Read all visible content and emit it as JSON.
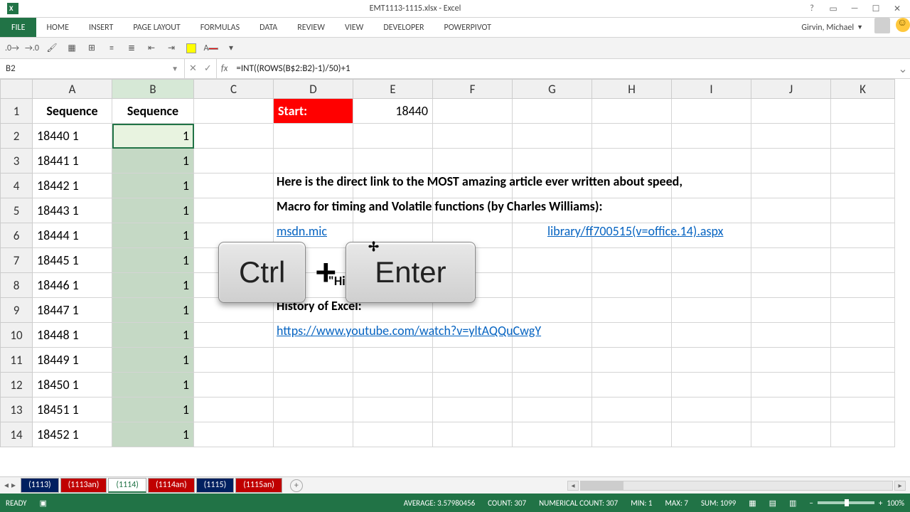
{
  "title": "EMT1113-1115.xlsx - Excel",
  "ribbon": {
    "file": "FILE",
    "tabs": [
      "HOME",
      "INSERT",
      "PAGE LAYOUT",
      "FORMULAS",
      "DATA",
      "REVIEW",
      "VIEW",
      "DEVELOPER",
      "POWERPIVOT"
    ],
    "user": "Girvin, Michael"
  },
  "help_icon": "?",
  "namebox": "B2",
  "formula": "=INT((ROWS(B$2:B2)-1)/50)+1",
  "columns": [
    "A",
    "B",
    "C",
    "D",
    "E",
    "F",
    "G",
    "H",
    "I",
    "J",
    "K"
  ],
  "row_numbers": [
    1,
    2,
    3,
    4,
    5,
    6,
    7,
    8,
    9,
    10,
    11,
    12,
    13,
    14
  ],
  "headers": {
    "A": "Sequence",
    "B": "Sequence"
  },
  "start_label": "Start:",
  "start_value": "18440",
  "colA": [
    "18440 1",
    "18441 1",
    "18442 1",
    "18443 1",
    "18444 1",
    "18445 1",
    "18446 1",
    "18447 1",
    "18448 1",
    "18449 1",
    "18450 1",
    "18451 1",
    "18452 1"
  ],
  "colB": [
    "1",
    "1",
    "1",
    "1",
    "1",
    "1",
    "1",
    "1",
    "1",
    "1",
    "1",
    "1",
    "1"
  ],
  "body_text": {
    "line1": "Here is the direct link to the MOST amazing article ever written about speed,",
    "line2": "Macro for timing and Volatile functions (by Charles Williams):",
    "link1_left": "msdn.mic",
    "link1_right": "library/ff700515(v=office.14).aspx",
    "high_prie": "\"High Prie",
    "history": "History of Excel:",
    "link2": "https://www.youtube.com/watch?v=yltAQQuCwgY"
  },
  "sheet_tabs": [
    {
      "label": "(1113)",
      "cls": "blue"
    },
    {
      "label": "(1113an)",
      "cls": "red"
    },
    {
      "label": "(1114)",
      "cls": "active"
    },
    {
      "label": "(1114an)",
      "cls": "red"
    },
    {
      "label": "(1115)",
      "cls": "blue"
    },
    {
      "label": "(1115an)",
      "cls": "red"
    }
  ],
  "status": {
    "ready": "READY",
    "avg": "AVERAGE: 3.57980456",
    "count": "COUNT: 307",
    "ncount": "NUMERICAL COUNT: 307",
    "min": "MIN: 1",
    "max": "MAX: 7",
    "sum": "SUM: 1099",
    "zoom": "100%"
  },
  "keycaps": {
    "ctrl": "Ctrl",
    "plus": "+",
    "enter": "Enter"
  }
}
